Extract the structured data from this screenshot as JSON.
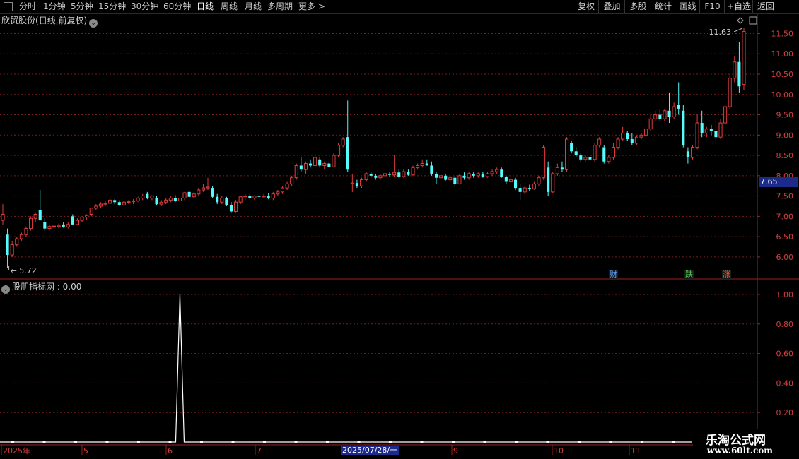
{
  "toolbar": {
    "periods": [
      "分时",
      "1分钟",
      "5分钟",
      "15分钟",
      "30分钟",
      "60分钟",
      "日线",
      "周线",
      "月线",
      "多周期",
      "更多"
    ],
    "active_period": "日线",
    "more_arrow": ">",
    "right_buttons": [
      "复权",
      "叠加",
      "多股",
      "统计",
      "画线",
      "F10",
      "+自选",
      "返回"
    ]
  },
  "main_chart": {
    "stock_name": "欣贸股份",
    "mode": "(日线,前复权)",
    "price_axis": [
      "11.50",
      "11.00",
      "10.50",
      "10.00",
      "9.50",
      "9.00",
      "8.50",
      "8.00",
      "7.50",
      "7.00",
      "6.50",
      "6.00"
    ],
    "last_price": "7.65",
    "high_marker": "11.63",
    "low_marker": "5.72",
    "events": [
      "财",
      "跌",
      "涨"
    ],
    "up_color": "#e03c3c",
    "down_color": "#54fcfc"
  },
  "indicator": {
    "title": "股朋指标网 : 0.00",
    "axis": [
      "1.00",
      "0.80",
      "0.60",
      "0.40",
      "0.20"
    ]
  },
  "date_axis": {
    "ticks": [
      "2025年",
      "5",
      "6",
      "7",
      "9",
      "10",
      "11"
    ],
    "cursor_label": "2025/07/28/一"
  },
  "watermark": {
    "line1": "乐淘公式网",
    "line2": "www.60lt.com"
  },
  "chart_data": {
    "type": "candlestick",
    "title": "欣贸股份(日线,前复权)",
    "ylim": [
      5.6,
      11.8
    ],
    "candles": [
      [
        6.9,
        7.3,
        6.8,
        7.05
      ],
      [
        6.55,
        6.7,
        5.72,
        6.05
      ],
      [
        6.05,
        6.4,
        6.0,
        6.3
      ],
      [
        6.3,
        6.5,
        6.25,
        6.45
      ],
      [
        6.45,
        6.6,
        6.4,
        6.55
      ],
      [
        6.55,
        6.75,
        6.5,
        6.7
      ],
      [
        6.7,
        7.0,
        6.65,
        6.95
      ],
      [
        6.95,
        7.1,
        6.85,
        7.05
      ],
      [
        7.15,
        7.65,
        6.95,
        6.9
      ],
      [
        6.85,
        6.95,
        6.65,
        6.7
      ],
      [
        6.7,
        6.8,
        6.65,
        6.75
      ],
      [
        6.75,
        6.8,
        6.7,
        6.76
      ],
      [
        6.75,
        6.82,
        6.7,
        6.78
      ],
      [
        6.8,
        6.85,
        6.72,
        6.74
      ],
      [
        6.74,
        6.85,
        6.7,
        6.8
      ],
      [
        7.0,
        7.05,
        6.8,
        6.8
      ],
      [
        6.8,
        6.95,
        6.78,
        6.9
      ],
      [
        6.9,
        7.0,
        6.85,
        6.98
      ],
      [
        6.98,
        7.05,
        6.9,
        7.02
      ],
      [
        7.05,
        7.2,
        7.0,
        7.2
      ],
      [
        7.2,
        7.3,
        7.15,
        7.25
      ],
      [
        7.25,
        7.35,
        7.2,
        7.3
      ],
      [
        7.3,
        7.38,
        7.25,
        7.32
      ],
      [
        7.32,
        7.48,
        7.3,
        7.4
      ],
      [
        7.4,
        7.42,
        7.3,
        7.35
      ],
      [
        7.35,
        7.4,
        7.25,
        7.28
      ],
      [
        7.28,
        7.38,
        7.25,
        7.35
      ],
      [
        7.35,
        7.4,
        7.3,
        7.36
      ],
      [
        7.36,
        7.42,
        7.3,
        7.38
      ],
      [
        7.38,
        7.48,
        7.35,
        7.45
      ],
      [
        7.45,
        7.55,
        7.4,
        7.5
      ],
      [
        7.55,
        7.6,
        7.42,
        7.45
      ],
      [
        7.45,
        7.52,
        7.4,
        7.5
      ],
      [
        7.45,
        7.5,
        7.28,
        7.3
      ],
      [
        7.3,
        7.4,
        7.25,
        7.35
      ],
      [
        7.35,
        7.45,
        7.3,
        7.4
      ],
      [
        7.4,
        7.5,
        7.35,
        7.45
      ],
      [
        7.45,
        7.52,
        7.35,
        7.38
      ],
      [
        7.38,
        7.48,
        7.35,
        7.45
      ],
      [
        7.45,
        7.6,
        7.4,
        7.58
      ],
      [
        7.6,
        7.62,
        7.45,
        7.48
      ],
      [
        7.48,
        7.6,
        7.45,
        7.55
      ],
      [
        7.55,
        7.7,
        7.5,
        7.65
      ],
      [
        7.65,
        7.8,
        7.6,
        7.7
      ],
      [
        7.7,
        7.95,
        7.65,
        7.72
      ],
      [
        7.7,
        7.75,
        7.45,
        7.48
      ],
      [
        7.48,
        7.55,
        7.3,
        7.35
      ],
      [
        7.35,
        7.5,
        7.3,
        7.45
      ],
      [
        7.45,
        7.48,
        7.25,
        7.28
      ],
      [
        7.28,
        7.35,
        7.1,
        7.12
      ],
      [
        7.12,
        7.4,
        7.1,
        7.35
      ],
      [
        7.35,
        7.5,
        7.3,
        7.48
      ],
      [
        7.48,
        7.55,
        7.4,
        7.5
      ],
      [
        7.5,
        7.55,
        7.42,
        7.45
      ],
      [
        7.45,
        7.52,
        7.4,
        7.5
      ],
      [
        7.5,
        7.55,
        7.45,
        7.48
      ],
      [
        7.48,
        7.55,
        7.45,
        7.5
      ],
      [
        7.5,
        7.58,
        7.42,
        7.45
      ],
      [
        7.45,
        7.6,
        7.4,
        7.55
      ],
      [
        7.55,
        7.65,
        7.5,
        7.6
      ],
      [
        7.6,
        7.75,
        7.55,
        7.7
      ],
      [
        7.7,
        7.85,
        7.65,
        7.8
      ],
      [
        7.8,
        8.0,
        7.75,
        7.95
      ],
      [
        7.95,
        8.3,
        7.9,
        8.25
      ],
      [
        8.25,
        8.45,
        8.1,
        8.15
      ],
      [
        8.15,
        8.35,
        8.05,
        8.3
      ],
      [
        8.3,
        8.4,
        8.2,
        8.25
      ],
      [
        8.25,
        8.5,
        8.2,
        8.45
      ],
      [
        8.4,
        8.45,
        8.2,
        8.25
      ],
      [
        8.25,
        8.35,
        8.15,
        8.3
      ],
      [
        8.3,
        8.35,
        8.2,
        8.22
      ],
      [
        8.22,
        8.55,
        8.2,
        8.5
      ],
      [
        8.5,
        8.8,
        8.45,
        8.75
      ],
      [
        8.75,
        8.95,
        8.7,
        8.9
      ],
      [
        8.95,
        9.85,
        8.1,
        8.15
      ],
      [
        7.8,
        8.05,
        7.6,
        7.82
      ],
      [
        7.82,
        7.9,
        7.7,
        7.75
      ],
      [
        7.75,
        7.95,
        7.7,
        7.9
      ],
      [
        7.9,
        8.1,
        7.85,
        8.05
      ],
      [
        8.05,
        8.1,
        7.95,
        8.0
      ],
      [
        8.0,
        8.05,
        7.9,
        7.95
      ],
      [
        7.95,
        8.05,
        7.9,
        8.0
      ],
      [
        8.0,
        8.1,
        7.95,
        8.05
      ],
      [
        8.05,
        8.1,
        7.98,
        8.02
      ],
      [
        8.02,
        8.5,
        7.98,
        8.08
      ],
      [
        8.08,
        8.15,
        7.95,
        7.98
      ],
      [
        7.98,
        8.15,
        7.95,
        8.1
      ],
      [
        8.1,
        8.15,
        8.0,
        8.02
      ],
      [
        8.02,
        8.25,
        8.0,
        8.2
      ],
      [
        8.2,
        8.3,
        8.15,
        8.25
      ],
      [
        8.25,
        8.4,
        8.2,
        8.3
      ],
      [
        8.3,
        8.4,
        8.25,
        8.25
      ],
      [
        8.25,
        8.35,
        8.0,
        8.05
      ],
      [
        8.05,
        8.1,
        7.8,
        7.95
      ],
      [
        7.95,
        8.05,
        7.9,
        8.0
      ],
      [
        8.0,
        8.05,
        7.88,
        7.9
      ],
      [
        7.9,
        8.0,
        7.85,
        7.95
      ],
      [
        7.95,
        8.0,
        7.75,
        7.8
      ],
      [
        7.8,
        8.05,
        7.78,
        8.0
      ],
      [
        8.0,
        8.08,
        7.9,
        7.95
      ],
      [
        7.95,
        8.1,
        7.9,
        8.05
      ],
      [
        8.05,
        8.1,
        7.95,
        8.0
      ],
      [
        8.0,
        8.08,
        7.95,
        8.05
      ],
      [
        8.05,
        8.1,
        7.95,
        7.98
      ],
      [
        7.98,
        8.1,
        7.95,
        8.05
      ],
      [
        8.05,
        8.15,
        8.0,
        8.1
      ],
      [
        8.1,
        8.2,
        8.05,
        8.15
      ],
      [
        8.15,
        8.2,
        7.95,
        7.98
      ],
      [
        7.98,
        8.0,
        7.8,
        7.85
      ],
      [
        7.85,
        7.95,
        7.8,
        7.9
      ],
      [
        7.9,
        7.95,
        7.65,
        7.7
      ],
      [
        7.7,
        7.8,
        7.4,
        7.6
      ],
      [
        7.6,
        7.75,
        7.55,
        7.7
      ],
      [
        7.7,
        7.78,
        7.62,
        7.68
      ],
      [
        7.68,
        7.85,
        7.65,
        7.8
      ],
      [
        7.8,
        8.0,
        7.75,
        7.95
      ],
      [
        7.95,
        8.75,
        7.9,
        8.7
      ],
      [
        8.2,
        8.35,
        7.5,
        7.6
      ],
      [
        7.6,
        8.1,
        7.58,
        8.05
      ],
      [
        8.05,
        8.3,
        8.0,
        8.2
      ],
      [
        8.2,
        8.35,
        8.1,
        8.15
      ],
      [
        8.15,
        8.95,
        8.1,
        8.9
      ],
      [
        8.8,
        8.85,
        8.55,
        8.6
      ],
      [
        8.6,
        8.7,
        8.45,
        8.5
      ],
      [
        8.5,
        8.55,
        8.35,
        8.4
      ],
      [
        8.4,
        8.5,
        8.35,
        8.45
      ],
      [
        8.45,
        8.55,
        8.35,
        8.4
      ],
      [
        8.4,
        8.8,
        8.35,
        8.75
      ],
      [
        8.75,
        8.95,
        8.7,
        8.9
      ],
      [
        8.7,
        8.75,
        8.3,
        8.35
      ],
      [
        8.35,
        8.5,
        8.3,
        8.45
      ],
      [
        8.45,
        8.8,
        8.4,
        8.7
      ],
      [
        8.7,
        8.95,
        8.65,
        8.9
      ],
      [
        8.9,
        9.2,
        8.85,
        9.05
      ],
      [
        9.05,
        9.1,
        8.85,
        8.9
      ],
      [
        8.9,
        9.05,
        8.75,
        8.8
      ],
      [
        8.8,
        9.0,
        8.75,
        8.95
      ],
      [
        8.95,
        9.05,
        8.9,
        9.0
      ],
      [
        9.0,
        9.2,
        8.95,
        9.15
      ],
      [
        9.15,
        9.5,
        9.1,
        9.4
      ],
      [
        9.4,
        9.6,
        9.35,
        9.5
      ],
      [
        9.5,
        9.65,
        9.35,
        9.4
      ],
      [
        9.4,
        9.65,
        9.35,
        9.6
      ],
      [
        9.6,
        10.05,
        9.3,
        9.45
      ],
      [
        9.45,
        9.8,
        9.4,
        9.7
      ],
      [
        9.75,
        10.3,
        9.5,
        9.65
      ],
      [
        9.6,
        9.75,
        8.7,
        8.75
      ],
      [
        8.6,
        8.7,
        8.3,
        8.45
      ],
      [
        8.45,
        8.75,
        8.4,
        8.7
      ],
      [
        8.7,
        9.5,
        8.65,
        9.3
      ],
      [
        9.3,
        9.6,
        8.95,
        9.05
      ],
      [
        9.05,
        9.2,
        8.95,
        9.15
      ],
      [
        9.15,
        9.25,
        9.0,
        9.1
      ],
      [
        9.1,
        9.4,
        8.75,
        8.95
      ],
      [
        8.95,
        9.4,
        8.9,
        9.3
      ],
      [
        9.3,
        9.75,
        9.25,
        9.7
      ],
      [
        9.7,
        10.5,
        9.65,
        10.4
      ],
      [
        10.4,
        10.95,
        10.3,
        10.8
      ],
      [
        10.8,
        11.3,
        10.05,
        10.2
      ],
      [
        10.25,
        11.63,
        10.1,
        11.55
      ]
    ],
    "indicator_series": {
      "name": "股朋指标网",
      "values_note_spike_index": 38,
      "ylim": [
        0,
        1.05
      ]
    }
  }
}
